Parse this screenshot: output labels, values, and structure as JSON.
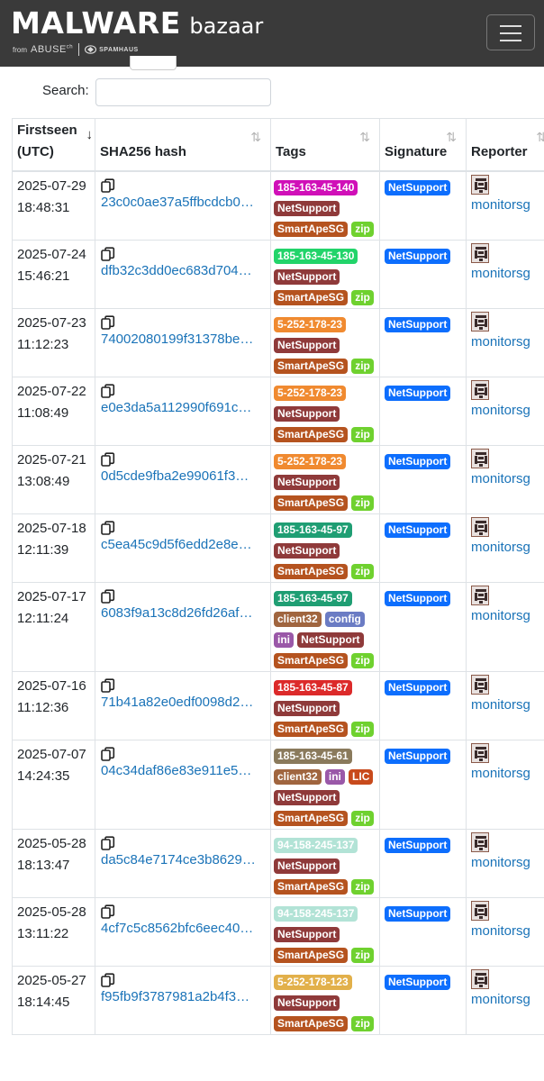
{
  "header": {
    "brand_main": "MALWARE",
    "brand_sub": "bazaar",
    "from_label": "from",
    "abuse_label": "ABUSE",
    "abuse_sup": "ch",
    "spamhaus_label": "SPAMHAUS"
  },
  "search": {
    "label": "Search:",
    "value": ""
  },
  "table": {
    "columns": [
      "Firstseen (UTC)",
      "SHA256 hash",
      "Tags",
      "Signature",
      "Reporter"
    ],
    "sort_active_column": "Firstseen (UTC)",
    "rows": [
      {
        "date": "2025-07-29 18:48:31",
        "hash": "23c0c0ae37a5ffbcdcb0…",
        "tags": [
          {
            "text": "185-163-45-140",
            "color": "#d010b8"
          },
          {
            "text": "NetSupport",
            "color": "#8f3a3a"
          },
          {
            "text": "SmartApeSG",
            "color": "#b5531f"
          },
          {
            "text": "zip",
            "color": "#6fd12f"
          }
        ],
        "signature": "NetSupport",
        "reporter": "monitorsg"
      },
      {
        "date": "2025-07-24 15:46:21",
        "hash": "dfb32c3dd0ec683d704…",
        "tags": [
          {
            "text": "185-163-45-130",
            "color": "#22d46a"
          },
          {
            "text": "NetSupport",
            "color": "#8f3a3a"
          },
          {
            "text": "SmartApeSG",
            "color": "#b5531f"
          },
          {
            "text": "zip",
            "color": "#6fd12f"
          }
        ],
        "signature": "NetSupport",
        "reporter": "monitorsg"
      },
      {
        "date": "2025-07-23 11:12:23",
        "hash": "74002080199f31378be…",
        "tags": [
          {
            "text": "5-252-178-23",
            "color": "#f08a30"
          },
          {
            "text": "NetSupport",
            "color": "#8f3a3a"
          },
          {
            "text": "SmartApeSG",
            "color": "#b5531f"
          },
          {
            "text": "zip",
            "color": "#6fd12f"
          }
        ],
        "signature": "NetSupport",
        "reporter": "monitorsg"
      },
      {
        "date": "2025-07-22 11:08:49",
        "hash": "e0e3da5a112990f691c…",
        "tags": [
          {
            "text": "5-252-178-23",
            "color": "#f08a30"
          },
          {
            "text": "NetSupport",
            "color": "#8f3a3a"
          },
          {
            "text": "SmartApeSG",
            "color": "#b5531f"
          },
          {
            "text": "zip",
            "color": "#6fd12f"
          }
        ],
        "signature": "NetSupport",
        "reporter": "monitorsg"
      },
      {
        "date": "2025-07-21 13:08:49",
        "hash": "0d5cde9fba2e99061f3…",
        "tags": [
          {
            "text": "5-252-178-23",
            "color": "#f08a30"
          },
          {
            "text": "NetSupport",
            "color": "#8f3a3a"
          },
          {
            "text": "SmartApeSG",
            "color": "#b5531f"
          },
          {
            "text": "zip",
            "color": "#6fd12f"
          }
        ],
        "signature": "NetSupport",
        "reporter": "monitorsg"
      },
      {
        "date": "2025-07-18 12:11:39",
        "hash": "c5ea45c9d5f6edd2e8e…",
        "tags": [
          {
            "text": "185-163-45-97",
            "color": "#1f9e73"
          },
          {
            "text": "NetSupport",
            "color": "#8f3a3a"
          },
          {
            "text": "SmartApeSG",
            "color": "#b5531f"
          },
          {
            "text": "zip",
            "color": "#6fd12f"
          }
        ],
        "signature": "NetSupport",
        "reporter": "monitorsg"
      },
      {
        "date": "2025-07-17 12:11:24",
        "hash": "6083f9a13c8d26fd26af…",
        "tags": [
          {
            "text": "185-163-45-97",
            "color": "#1f9e73"
          },
          {
            "text": "client32",
            "color": "#a0653f"
          },
          {
            "text": "config",
            "color": "#6b7cc4"
          },
          {
            "text": "ini",
            "color": "#9a58a8"
          },
          {
            "text": "NetSupport",
            "color": "#8f3a3a"
          },
          {
            "text": "SmartApeSG",
            "color": "#b5531f"
          },
          {
            "text": "zip",
            "color": "#6fd12f"
          }
        ],
        "signature": "NetSupport",
        "reporter": "monitorsg"
      },
      {
        "date": "2025-07-16 11:12:36",
        "hash": "71b41a82e0edf0098d2…",
        "tags": [
          {
            "text": "185-163-45-87",
            "color": "#dc2a2a"
          },
          {
            "text": "NetSupport",
            "color": "#8f3a3a"
          },
          {
            "text": "SmartApeSG",
            "color": "#b5531f"
          },
          {
            "text": "zip",
            "color": "#6fd12f"
          }
        ],
        "signature": "NetSupport",
        "reporter": "monitorsg"
      },
      {
        "date": "2025-07-07 14:24:35",
        "hash": "04c34daf86e83e911e5…",
        "tags": [
          {
            "text": "185-163-45-61",
            "color": "#8a7a5c"
          },
          {
            "text": "client32",
            "color": "#a0653f"
          },
          {
            "text": "ini",
            "color": "#9a58a8"
          },
          {
            "text": "LIC",
            "color": "#c84a1c"
          },
          {
            "text": "NetSupport",
            "color": "#8f3a3a"
          },
          {
            "text": "SmartApeSG",
            "color": "#b5531f"
          },
          {
            "text": "zip",
            "color": "#6fd12f"
          }
        ],
        "signature": "NetSupport",
        "reporter": "monitorsg"
      },
      {
        "date": "2025-05-28 18:13:47",
        "hash": "da5c84e7174ce3b8629…",
        "tags": [
          {
            "text": "94-158-245-137",
            "color": "#b2e3d6"
          },
          {
            "text": "NetSupport",
            "color": "#8f3a3a"
          },
          {
            "text": "SmartApeSG",
            "color": "#b5531f"
          },
          {
            "text": "zip",
            "color": "#6fd12f"
          }
        ],
        "signature": "NetSupport",
        "reporter": "monitorsg"
      },
      {
        "date": "2025-05-28 13:11:22",
        "hash": "4cf7c5c8562bfc6eec40…",
        "tags": [
          {
            "text": "94-158-245-137",
            "color": "#b2e3d6"
          },
          {
            "text": "NetSupport",
            "color": "#8f3a3a"
          },
          {
            "text": "SmartApeSG",
            "color": "#b5531f"
          },
          {
            "text": "zip",
            "color": "#6fd12f"
          }
        ],
        "signature": "NetSupport",
        "reporter": "monitorsg"
      },
      {
        "date": "2025-05-27 18:14:45",
        "hash": "f95fb9f3787981a2b4f3…",
        "tags": [
          {
            "text": "5-252-178-123",
            "color": "#e2b04a"
          },
          {
            "text": "NetSupport",
            "color": "#8f3a3a"
          },
          {
            "text": "SmartApeSG",
            "color": "#b5531f"
          },
          {
            "text": "zip",
            "color": "#6fd12f"
          }
        ],
        "signature": "NetSupport",
        "reporter": "monitorsg"
      }
    ]
  },
  "colors": {
    "navbar": "#3a3a3a",
    "link": "#1a73b8",
    "signature_badge": "#0d6efd"
  }
}
